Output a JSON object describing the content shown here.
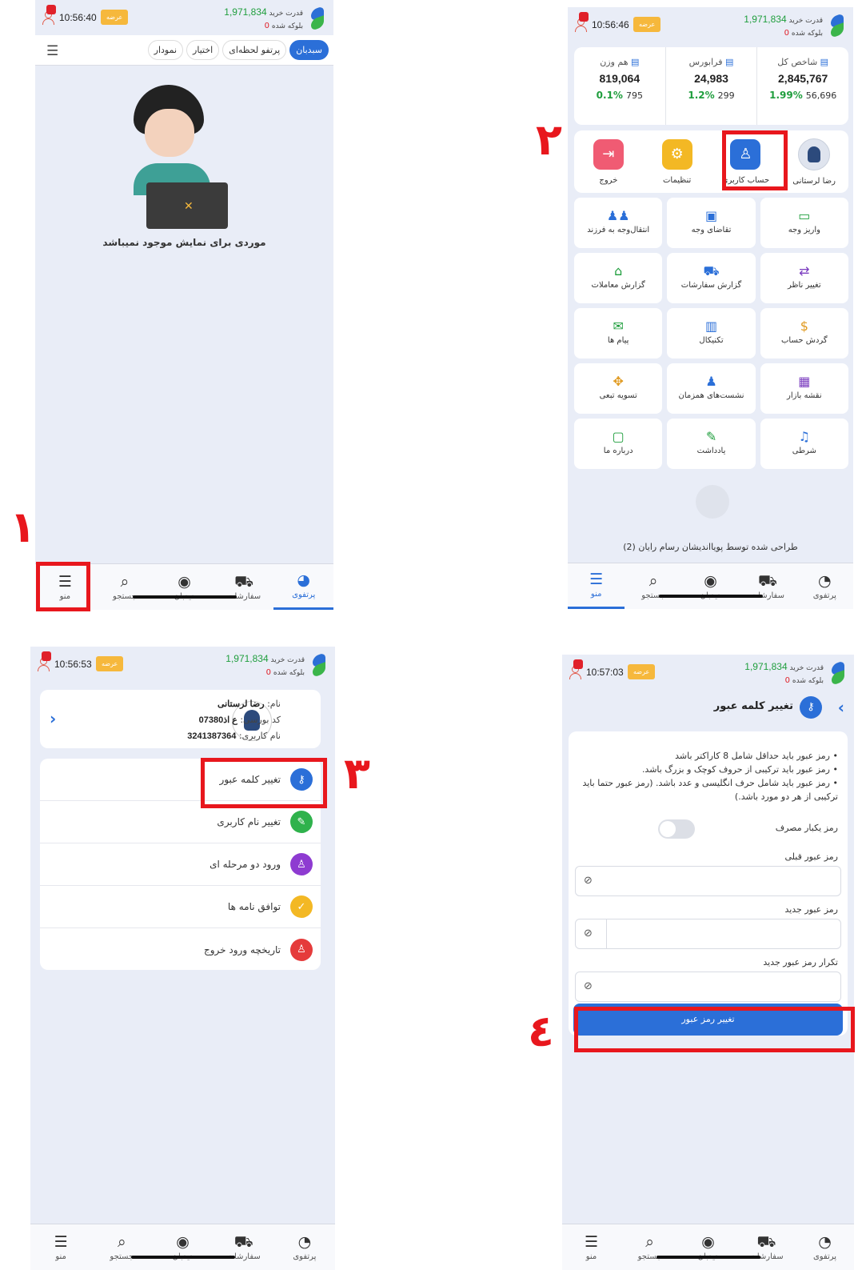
{
  "status": {
    "buy_label": "قدرت خرید",
    "buy_value": "1,971,834",
    "blocked_label": "بلوکه شده",
    "blocked_value": "0",
    "session_badge": "عرضه",
    "times": [
      "10:56:40",
      "10:56:46",
      "10:56:53",
      "10:57:03"
    ]
  },
  "bottom_nav": [
    "پرتفوی",
    "سفارشات",
    "دیدبان",
    "جستجو",
    "منو"
  ],
  "screen1": {
    "tabs": [
      "سبدبان",
      "پرتفو لحظه‌ای",
      "اختیار",
      "نمودار"
    ],
    "empty_text": "موردی برای نمایش موجود نمیباشد"
  },
  "screen2": {
    "indices": [
      {
        "title": "شاخص کل",
        "value": "2,845,767",
        "pct": "1.99%",
        "change": "56,696"
      },
      {
        "title": "فرابورس",
        "value": "24,983",
        "pct": "1.2%",
        "change": "299"
      },
      {
        "title": "هم وزن",
        "value": "819,064",
        "pct": "0.1%",
        "change": "795"
      }
    ],
    "account": [
      "رضا لرستانی",
      "حساب کاربری",
      "تنظیمات",
      "خروج"
    ],
    "grid": [
      "واریز وجه",
      "تقاضای وجه",
      "انتقال‌وجه به فرزند",
      "تغییر ناظر",
      "گزارش سفارشات",
      "گزارش معاملات",
      "گردش حساب",
      "تکنیکال",
      "پیام ها",
      "نقشه بازار",
      "نشست‌های همزمان",
      "تسویه تبعی",
      "شرطی",
      "یادداشت",
      "درباره ما"
    ],
    "credit": "طراحی شده توسط پویااندیشان رسام رایان (2)"
  },
  "screen3": {
    "name_label": "نام:",
    "name": "رضا لرستانی",
    "code_label": "کد بورسی:",
    "code": "ع اذ07380",
    "user_label": "نام کاربری:",
    "user": "3241387364",
    "menu": [
      "تغییر کلمه عبور",
      "تغییر نام کاربری",
      "ورود دو مرحله ای",
      "توافق نامه ها",
      "تاریخچه ورود خروج"
    ],
    "menu_colors": [
      "#2b6fd8",
      "#2fb24c",
      "#8e3bd1",
      "#f3b824",
      "#e53b3b"
    ]
  },
  "screen4": {
    "title": "تغییر کلمه عبور",
    "rules": [
      "رمز عبور باید حداقل شامل 8 کاراکتر باشد",
      "رمز عبور باید ترکیبی از حروف کوچک و بزرگ باشد.",
      "رمز عبور باید شامل حرف انگلیسی و عدد باشد. (رمز عبور حتما باید ترکیبی از هر دو مورد باشد.)"
    ],
    "one_time_label": "رمز یکبار مصرف",
    "old_label": "رمز عبور قبلی",
    "new_label": "رمز عبور جدید",
    "repeat_label": "تکرار رمز عبور جدید",
    "submit": "تغییر رمز عبور"
  },
  "steps": [
    "۱",
    "۲",
    "۳",
    "٤"
  ],
  "highlight_color": "#e8171d"
}
